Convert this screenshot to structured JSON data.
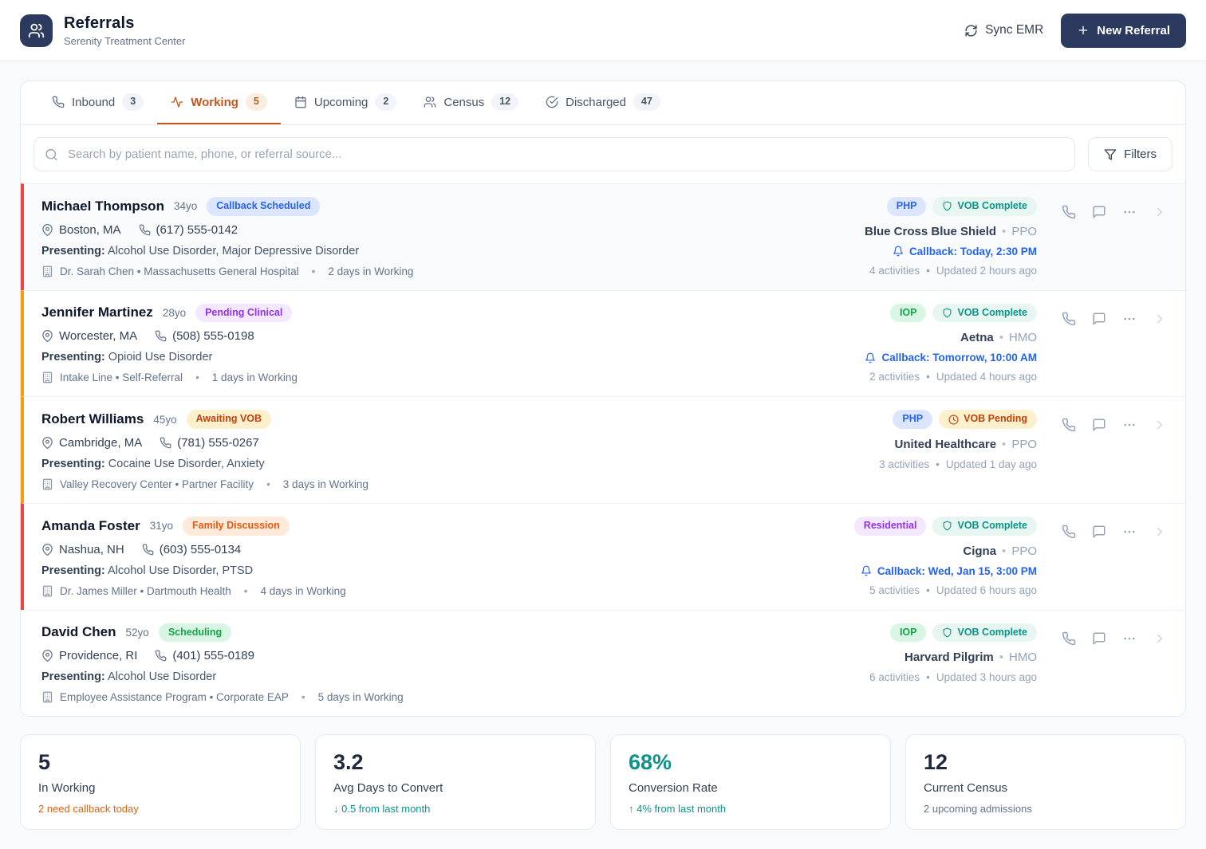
{
  "header": {
    "title": "Referrals",
    "subtitle": "Serenity Treatment Center",
    "sync_label": "Sync EMR",
    "new_referral_label": "New Referral"
  },
  "tabs": [
    {
      "label": "Inbound",
      "count": "3"
    },
    {
      "label": "Working",
      "count": "5"
    },
    {
      "label": "Upcoming",
      "count": "2"
    },
    {
      "label": "Census",
      "count": "12"
    },
    {
      "label": "Discharged",
      "count": "47"
    }
  ],
  "search": {
    "placeholder": "Search by patient name, phone, or referral source...",
    "filters_label": "Filters"
  },
  "patients": [
    {
      "name": "Michael Thompson",
      "age": "34yo",
      "status": "Callback Scheduled",
      "location": "Boston, MA",
      "phone": "(617) 555-0142",
      "presenting_label": "Presenting:",
      "presenting": "Alcohol Use Disorder, Major Depressive Disorder",
      "source": "Dr. Sarah Chen • Massachusetts General Hospital",
      "days": "2 days in Working",
      "level": "PHP",
      "vob": "VOB Complete",
      "insurance": "Blue Cross Blue Shield",
      "plan": "PPO",
      "callback": "Callback: Today, 2:30 PM",
      "activities": "4 activities",
      "updated": "Updated 2 hours ago"
    },
    {
      "name": "Jennifer Martinez",
      "age": "28yo",
      "status": "Pending Clinical",
      "location": "Worcester, MA",
      "phone": "(508) 555-0198",
      "presenting_label": "Presenting:",
      "presenting": "Opioid Use Disorder",
      "source": "Intake Line • Self-Referral",
      "days": "1 days in Working",
      "level": "IOP",
      "vob": "VOB Complete",
      "insurance": "Aetna",
      "plan": "HMO",
      "callback": "Callback: Tomorrow, 10:00 AM",
      "activities": "2 activities",
      "updated": "Updated 4 hours ago"
    },
    {
      "name": "Robert Williams",
      "age": "45yo",
      "status": "Awaiting VOB",
      "location": "Cambridge, MA",
      "phone": "(781) 555-0267",
      "presenting_label": "Presenting:",
      "presenting": "Cocaine Use Disorder, Anxiety",
      "source": "Valley Recovery Center • Partner Facility",
      "days": "3 days in Working",
      "level": "PHP",
      "vob": "VOB Pending",
      "insurance": "United Healthcare",
      "plan": "PPO",
      "activities": "3 activities",
      "updated": "Updated 1 day ago"
    },
    {
      "name": "Amanda Foster",
      "age": "31yo",
      "status": "Family Discussion",
      "location": "Nashua, NH",
      "phone": "(603) 555-0134",
      "presenting_label": "Presenting:",
      "presenting": "Alcohol Use Disorder, PTSD",
      "source": "Dr. James Miller • Dartmouth Health",
      "days": "4 days in Working",
      "level": "Residential",
      "vob": "VOB Complete",
      "insurance": "Cigna",
      "plan": "PPO",
      "callback": "Callback: Wed, Jan 15, 3:00 PM",
      "activities": "5 activities",
      "updated": "Updated 6 hours ago"
    },
    {
      "name": "David Chen",
      "age": "52yo",
      "status": "Scheduling",
      "location": "Providence, RI",
      "phone": "(401) 555-0189",
      "presenting_label": "Presenting:",
      "presenting": "Alcohol Use Disorder",
      "source": "Employee Assistance Program • Corporate EAP",
      "days": "5 days in Working",
      "level": "IOP",
      "vob": "VOB Complete",
      "insurance": "Harvard Pilgrim",
      "plan": "HMO",
      "activities": "6 activities",
      "updated": "Updated 3 hours ago"
    }
  ],
  "stats": [
    {
      "value": "5",
      "label": "In Working",
      "sub": "2 need callback today"
    },
    {
      "value": "3.2",
      "label": "Avg Days to Convert",
      "sub": "↓ 0.5 from last month"
    },
    {
      "value": "68%",
      "label": "Conversion Rate",
      "sub": "↑ 4% from last month"
    },
    {
      "value": "12",
      "label": "Current Census",
      "sub": "2 upcoming admissions"
    }
  ],
  "colors": {
    "page_bg": "#f8fafc",
    "brand_navy": "#2b3a5e",
    "accent_orange": "#c4561b",
    "callback_blue": "#2563eb",
    "teal": "#0d9488",
    "card_border_red": "#ef4444",
    "card_border_amber": "#f59e0b"
  }
}
